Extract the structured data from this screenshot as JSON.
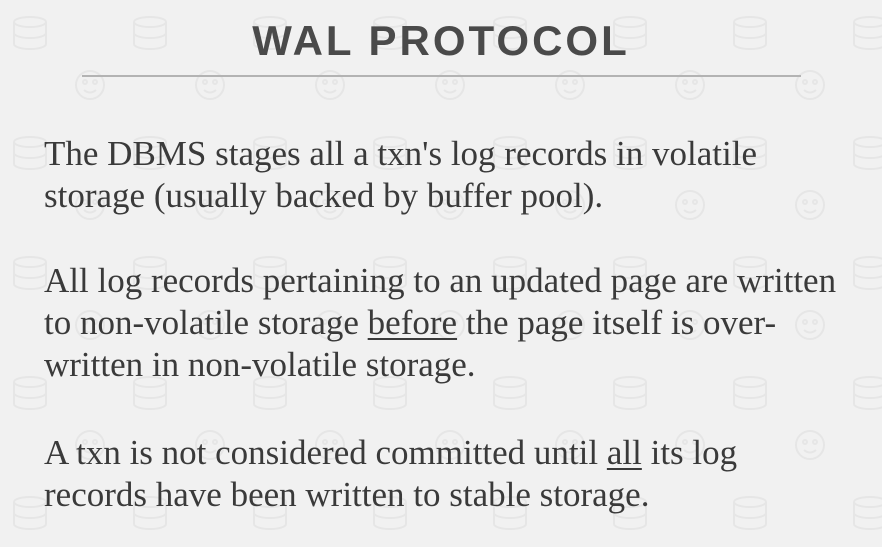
{
  "slide": {
    "title": "WAL PROTOCOL",
    "paragraphs": [
      {
        "text": "The DBMS stages all a txn's log records in volatile storage (usually backed by buffer pool)."
      },
      {
        "before": "All log records pertaining to an updated page are written to non-volatile storage ",
        "underlined": "before",
        "after": " the page itself is over-written in non-volatile storage."
      },
      {
        "before": "A txn is not considered committed until ",
        "underlined": "all",
        "after": " its log records have been written to stable storage."
      }
    ]
  },
  "colors": {
    "background": "#f1f1f1",
    "text": "#3a3a3a",
    "title": "#4a4a4a",
    "rule": "#b3b3b3"
  }
}
